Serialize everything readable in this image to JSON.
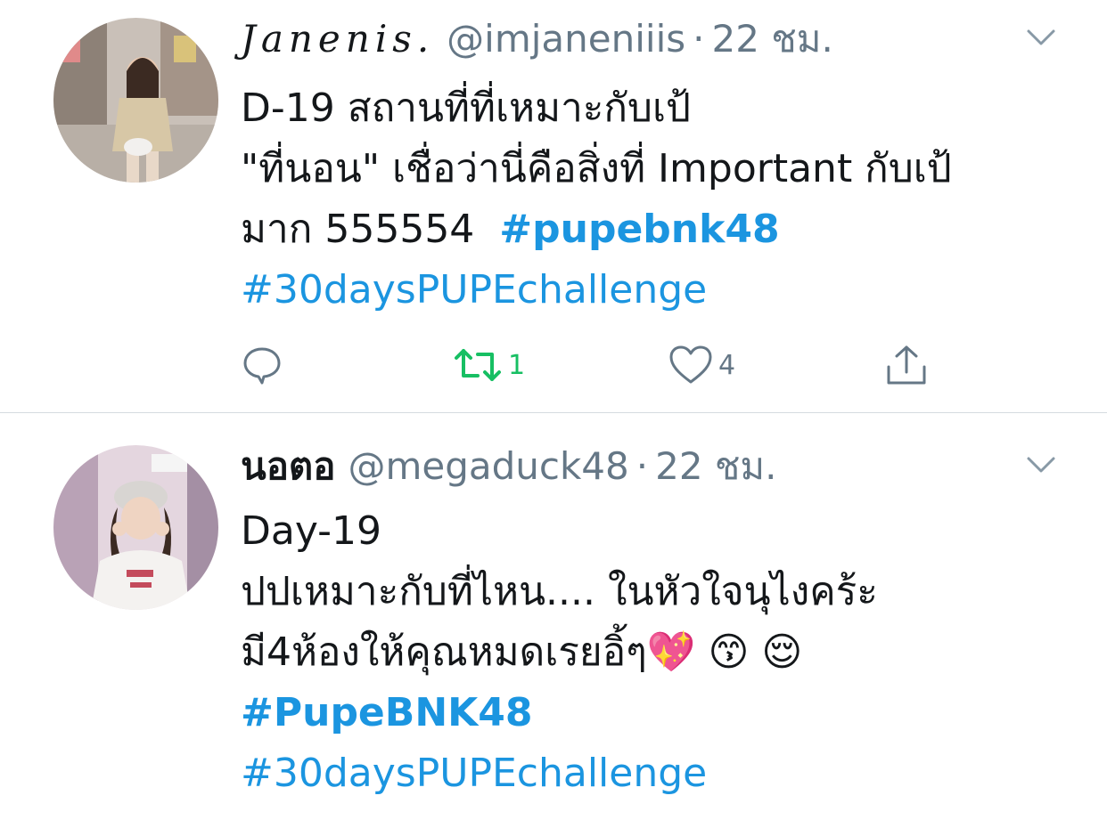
{
  "tweets": [
    {
      "display_name": "Janenis.",
      "handle": "@imjaneniiis",
      "separator": "·",
      "time": "22 ชม.",
      "lines": [
        {
          "text": "D-19 สถานที่ที่เหมาะกับเป้"
        },
        {
          "text": "\"ที่นอน\" เชื่อว่านี่คือสิ่งที่ Important กับเป้"
        },
        {
          "text": "มาก 555554  ",
          "hashtag": "#pupebnk48"
        },
        {
          "hashtag2": "#30daysPUPEchallenge"
        }
      ],
      "actions": {
        "reply_icon": "reply-icon",
        "retweet_icon": "retweet-icon",
        "retweet_count": "1",
        "like_icon": "heart-icon",
        "like_count": "4",
        "share_icon": "share-icon"
      }
    },
    {
      "display_name": "นอตอ",
      "handle": "@megaduck48",
      "separator": "·",
      "time": "22 ชม.",
      "lines": [
        {
          "text": "Day-19"
        },
        {
          "text": "ปปเหมาะกับที่ไหน.... ในหัวใจนุไงคร้ะ"
        },
        {
          "text": "มี4ห้องให้คุณหมดเรยอิ้ๆ💖 😙 😌"
        },
        {
          "hashtag": "#PupeBNK48"
        },
        {
          "hashtag2": "#30daysPUPEchallenge"
        }
      ]
    }
  ],
  "colors": {
    "text": "#14171a",
    "secondary": "#657786",
    "link": "#1b95e0",
    "retweet_active": "#17bf63",
    "divider": "#d5dbe0"
  }
}
